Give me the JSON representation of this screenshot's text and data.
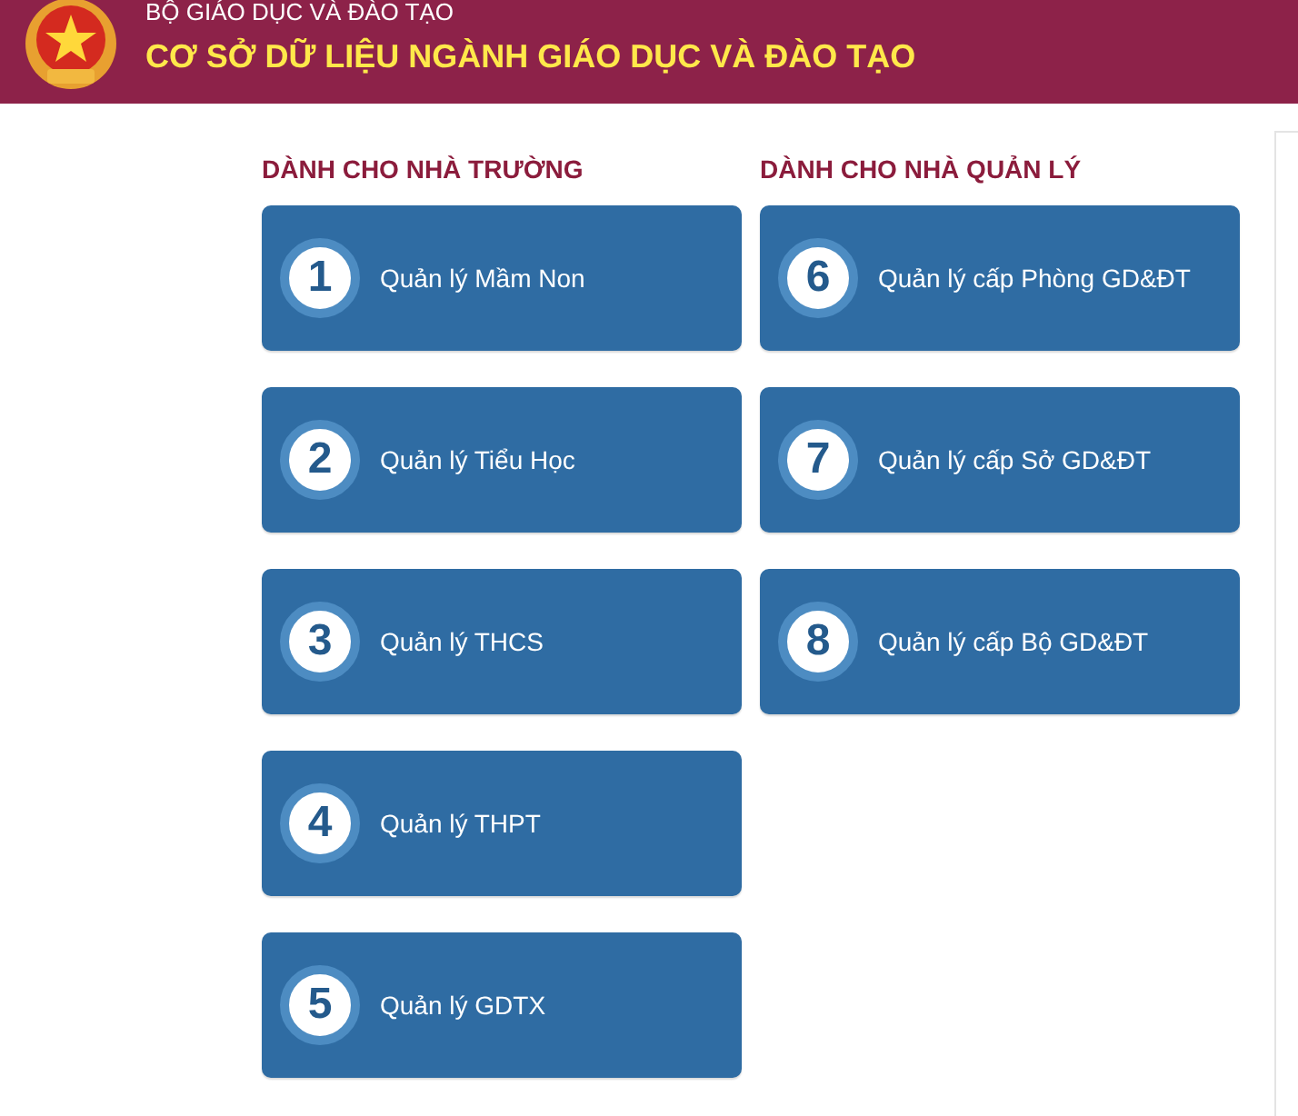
{
  "header": {
    "agency": "BỘ GIÁO DỤC VÀ ĐÀO TẠO",
    "title": "CƠ SỞ DỮ LIỆU NGÀNH GIÁO DỤC VÀ ĐÀO TẠO"
  },
  "sections": [
    {
      "heading": "DÀNH CHO NHÀ TRƯỜNG",
      "items": [
        {
          "number": "1",
          "label": "Quản lý Mầm Non"
        },
        {
          "number": "2",
          "label": "Quản lý Tiểu Học"
        },
        {
          "number": "3",
          "label": "Quản lý THCS"
        },
        {
          "number": "4",
          "label": "Quản lý THPT"
        },
        {
          "number": "5",
          "label": "Quản lý GDTX"
        }
      ]
    },
    {
      "heading": "DÀNH CHO NHÀ QUẢN LÝ",
      "items": [
        {
          "number": "6",
          "label": "Quản lý cấp Phòng GD&ĐT"
        },
        {
          "number": "7",
          "label": "Quản lý cấp Sở GD&ĐT"
        },
        {
          "number": "8",
          "label": "Quản lý cấp Bộ GD&ĐT"
        }
      ]
    }
  ]
}
